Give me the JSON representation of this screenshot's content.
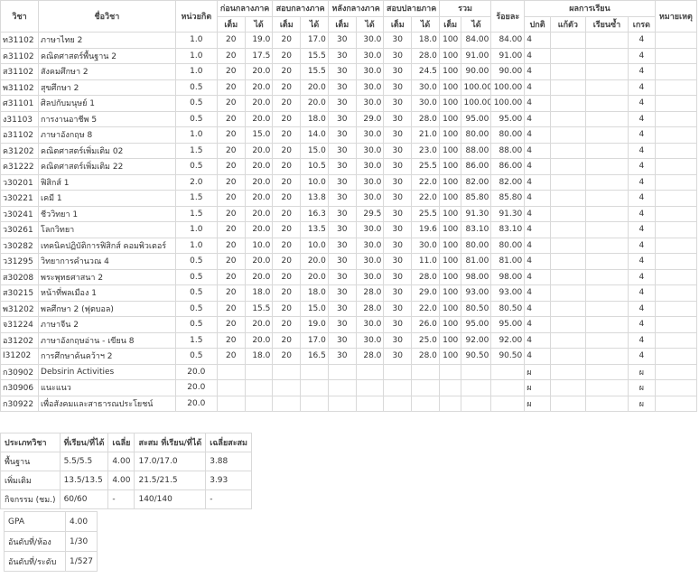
{
  "headers": {
    "code": "วิชา",
    "name": "ชื่อวิชา",
    "credit": "หน่วยกิต",
    "before_mid": "ก่อนกลางภาค",
    "mid_exam": "สอบกลางภาค",
    "after_mid": "หลังกลางภาค",
    "final_exam": "สอบปลายภาค",
    "total": "รวม",
    "percent": "ร้อยละ",
    "result": "ผลการเรียน",
    "remark": "หมายเหตุ",
    "full": "เต็ม",
    "got": "ได้",
    "normal": "ปกติ",
    "fix": "แก้ตัว",
    "retake": "เรียนซ้ำ",
    "grade": "เกรด"
  },
  "rows": [
    [
      "ท31102",
      "ภาษาไทย 2",
      "1.0",
      "20",
      "19.0",
      "20",
      "17.0",
      "30",
      "30.0",
      "30",
      "18.0",
      "100",
      "84.00",
      "84.00",
      "4",
      "",
      "",
      "4",
      ""
    ],
    [
      "ค31102",
      "คณิตศาสตร์พื้นฐาน 2",
      "1.0",
      "20",
      "17.5",
      "20",
      "15.5",
      "30",
      "30.0",
      "30",
      "28.0",
      "100",
      "91.00",
      "91.00",
      "4",
      "",
      "",
      "4",
      ""
    ],
    [
      "ส31102",
      "สังคมศึกษา 2",
      "1.0",
      "20",
      "20.0",
      "20",
      "15.5",
      "30",
      "30.0",
      "30",
      "24.5",
      "100",
      "90.00",
      "90.00",
      "4",
      "",
      "",
      "4",
      ""
    ],
    [
      "พ31102",
      "สุขศึกษา 2",
      "0.5",
      "20",
      "20.0",
      "20",
      "20.0",
      "30",
      "30.0",
      "30",
      "30.0",
      "100",
      "100.00",
      "100.00",
      "4",
      "",
      "",
      "4",
      ""
    ],
    [
      "ศ31101",
      "ศิลปกับมนุษย์ 1",
      "0.5",
      "20",
      "20.0",
      "20",
      "20.0",
      "30",
      "30.0",
      "30",
      "30.0",
      "100",
      "100.00",
      "100.00",
      "4",
      "",
      "",
      "4",
      ""
    ],
    [
      "ง31103",
      "การงานอาชีพ 5",
      "0.5",
      "20",
      "20.0",
      "20",
      "18.0",
      "30",
      "29.0",
      "30",
      "28.0",
      "100",
      "95.00",
      "95.00",
      "4",
      "",
      "",
      "4",
      ""
    ],
    [
      "อ31102",
      "ภาษาอังกฤษ 8",
      "1.0",
      "20",
      "15.0",
      "20",
      "14.0",
      "30",
      "30.0",
      "30",
      "21.0",
      "100",
      "80.00",
      "80.00",
      "4",
      "",
      "",
      "4",
      ""
    ],
    [
      "ค31202",
      "คณิตศาสตร์เพิ่มเติม 02",
      "1.5",
      "20",
      "20.0",
      "20",
      "15.0",
      "30",
      "30.0",
      "30",
      "23.0",
      "100",
      "88.00",
      "88.00",
      "4",
      "",
      "",
      "4",
      ""
    ],
    [
      "ค31222",
      "คณิตศาสตร์เพิ่มเติม 22",
      "0.5",
      "20",
      "20.0",
      "20",
      "10.5",
      "30",
      "30.0",
      "30",
      "25.5",
      "100",
      "86.00",
      "86.00",
      "4",
      "",
      "",
      "4",
      ""
    ],
    [
      "ว30201",
      "ฟิสิกส์ 1",
      "2.0",
      "20",
      "20.0",
      "20",
      "10.0",
      "30",
      "30.0",
      "30",
      "22.0",
      "100",
      "82.00",
      "82.00",
      "4",
      "",
      "",
      "4",
      ""
    ],
    [
      "ว30221",
      "เคมี 1",
      "1.5",
      "20",
      "20.0",
      "20",
      "13.8",
      "30",
      "30.0",
      "30",
      "22.0",
      "100",
      "85.80",
      "85.80",
      "4",
      "",
      "",
      "4",
      ""
    ],
    [
      "ว30241",
      "ชีววิทยา 1",
      "1.5",
      "20",
      "20.0",
      "20",
      "16.3",
      "30",
      "29.5",
      "30",
      "25.5",
      "100",
      "91.30",
      "91.30",
      "4",
      "",
      "",
      "4",
      ""
    ],
    [
      "ว30261",
      "โลกวิทยา",
      "1.0",
      "20",
      "20.0",
      "20",
      "13.5",
      "30",
      "30.0",
      "30",
      "19.6",
      "100",
      "83.10",
      "83.10",
      "4",
      "",
      "",
      "4",
      ""
    ],
    [
      "ว30282",
      "เทคนิคปฏิบัติการฟิสิกส์ คอมพิวเตอร์",
      "1.0",
      "20",
      "10.0",
      "20",
      "10.0",
      "30",
      "30.0",
      "30",
      "30.0",
      "100",
      "80.00",
      "80.00",
      "4",
      "",
      "",
      "4",
      ""
    ],
    [
      "ว31295",
      "วิทยาการคำนวณ 4",
      "0.5",
      "20",
      "20.0",
      "20",
      "20.0",
      "30",
      "30.0",
      "30",
      "11.0",
      "100",
      "81.00",
      "81.00",
      "4",
      "",
      "",
      "4",
      ""
    ],
    [
      "ส30208",
      "พระพุทธศาสนา 2",
      "0.5",
      "20",
      "20.0",
      "20",
      "20.0",
      "30",
      "30.0",
      "30",
      "28.0",
      "100",
      "98.00",
      "98.00",
      "4",
      "",
      "",
      "4",
      ""
    ],
    [
      "ส30215",
      "หน้าที่พลเมือง 1",
      "0.5",
      "20",
      "18.0",
      "20",
      "18.0",
      "30",
      "28.0",
      "30",
      "29.0",
      "100",
      "93.00",
      "93.00",
      "4",
      "",
      "",
      "4",
      ""
    ],
    [
      "พ31202",
      "พลศึกษา 2 (ฟุตบอล)",
      "0.5",
      "20",
      "15.5",
      "20",
      "15.0",
      "30",
      "28.0",
      "30",
      "22.0",
      "100",
      "80.50",
      "80.50",
      "4",
      "",
      "",
      "4",
      ""
    ],
    [
      "จ31224",
      "ภาษาจีน 2",
      "0.5",
      "20",
      "20.0",
      "20",
      "19.0",
      "30",
      "30.0",
      "30",
      "26.0",
      "100",
      "95.00",
      "95.00",
      "4",
      "",
      "",
      "4",
      ""
    ],
    [
      "อ31202",
      "ภาษาอังกฤษอ่าน - เขียน 8",
      "1.5",
      "20",
      "20.0",
      "20",
      "17.0",
      "30",
      "30.0",
      "30",
      "25.0",
      "100",
      "92.00",
      "92.00",
      "4",
      "",
      "",
      "4",
      ""
    ],
    [
      "I31202",
      "การศึกษาค้นคว้าฯ 2",
      "0.5",
      "20",
      "18.0",
      "20",
      "16.5",
      "30",
      "28.0",
      "30",
      "28.0",
      "100",
      "90.50",
      "90.50",
      "4",
      "",
      "",
      "4",
      ""
    ],
    [
      "ก30902",
      "Debsirin Activities",
      "20.0",
      "",
      "",
      "",
      "",
      "",
      "",
      "",
      "",
      "",
      "",
      "",
      "ผ",
      "",
      "",
      "ผ",
      ""
    ],
    [
      "ก30906",
      "แนะแนว",
      "20.0",
      "",
      "",
      "",
      "",
      "",
      "",
      "",
      "",
      "",
      "",
      "",
      "ผ",
      "",
      "",
      "ผ",
      ""
    ],
    [
      "ก30922",
      "เพื่อสังคมและสาธารณประโยชน์",
      "20.0",
      "",
      "",
      "",
      "",
      "",
      "",
      "",
      "",
      "",
      "",
      "",
      "ผ",
      "",
      "",
      "ผ",
      ""
    ]
  ],
  "summary": {
    "headers": [
      "ประเภทวิชา",
      "ที่เรียน/ที่ได้",
      "เฉลี่ย",
      "สะสม ที่เรียน/ที่ได้",
      "เฉลี่ยสะสม"
    ],
    "rows": [
      [
        "พื้นฐาน",
        "5.5/5.5",
        "4.00",
        "17.0/17.0",
        "3.88"
      ],
      [
        "เพิ่มเติม",
        "13.5/13.5",
        "4.00",
        "21.5/21.5",
        "3.93"
      ],
      [
        "กิจกรรม (ชม.)",
        "60/60",
        "-",
        "140/140",
        "-"
      ]
    ]
  },
  "gpa": [
    [
      "GPA",
      "4.00"
    ],
    [
      "อันดับที่/ห้อง",
      "1/30"
    ],
    [
      "อันดับที่/ระดับ",
      "1/527"
    ]
  ]
}
